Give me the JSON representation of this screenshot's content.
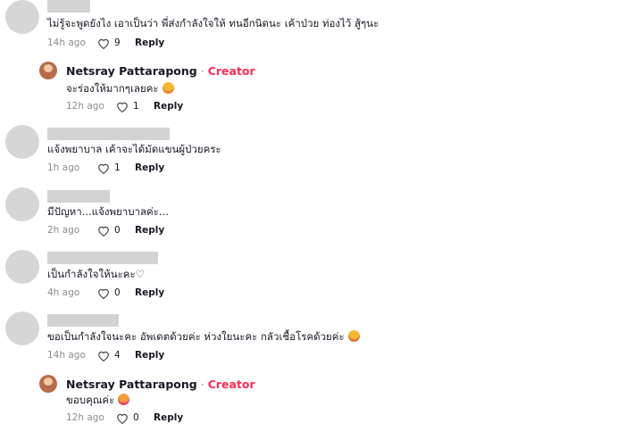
{
  "comments": [
    {
      "text": "ไม่รู้จะพูดยังไง เอาเป็นว่า พี่ส่งกำลังใจให้ ทนอีกนิดนะ เค้าป่วย ท่องไว้ สู้ๆนะ",
      "time": "14h ago",
      "likes": "9",
      "reply": "Reply"
    },
    {
      "text": "แจ้งพยาบาล เค้าจะได้มัดแขนผู้ป่วยคระ",
      "time": "1h ago",
      "likes": "1",
      "reply": "Reply"
    },
    {
      "text": "มีปัญหา...แจ้งพยาบาลค่ะ...",
      "time": "2h ago",
      "likes": "0",
      "reply": "Reply"
    },
    {
      "text": "เป็นกำลังใจให้นะคะ♡",
      "time": "4h ago",
      "likes": "0",
      "reply": "Reply"
    },
    {
      "text": "ขอเป็นกำลังใจนะคะ อัพเดตด้วยค่ะ ห่วงใยนะคะ กลัวเชื้อโรคด้วยค่ะ",
      "time": "14h ago",
      "likes": "4",
      "reply": "Reply"
    }
  ],
  "creator_replies": [
    {
      "name": "Netsray Pattarapong",
      "separator": "·",
      "badge": "Creator",
      "text": "จะร่องให้มากๆเลยคะ",
      "emoji": "smiling-face-with-hearts-emoji",
      "time": "12h ago",
      "likes": "1",
      "reply": "Reply"
    },
    {
      "name": "Netsray Pattarapong",
      "separator": "·",
      "badge": "Creator",
      "text": "ขอบคุณค่ะ",
      "emoji": "heart-face-emoji",
      "time": "12h ago",
      "likes": "0",
      "reply": "Reply"
    }
  ],
  "colors": {
    "creator_badge": "#fe2c55",
    "meta_gray": "#8a8b91",
    "placeholder_gray": "#d3d3d3"
  }
}
